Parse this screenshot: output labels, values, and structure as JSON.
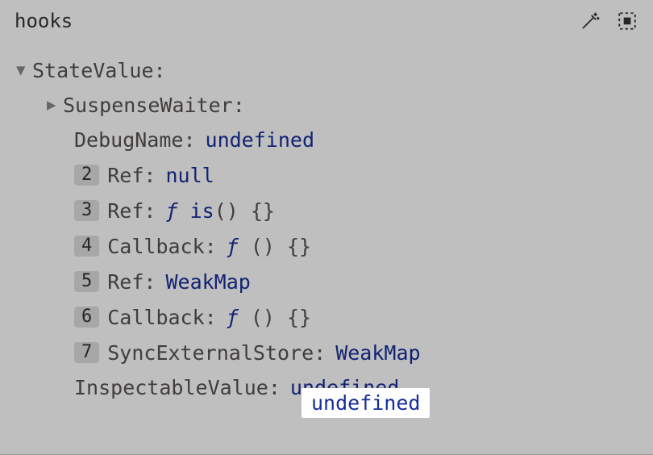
{
  "header": {
    "title": "hooks"
  },
  "tree": {
    "root": {
      "key": "StateValue",
      "expanded": true,
      "children": [
        {
          "key": "SuspenseWaiter",
          "expanded": false,
          "value": ""
        },
        {
          "key": "DebugName",
          "value": "undefined",
          "valueType": "undefined"
        },
        {
          "idx": "2",
          "key": "Ref",
          "value": "null",
          "valueType": "null"
        },
        {
          "idx": "3",
          "key": "Ref",
          "funcName": "is",
          "valueType": "func"
        },
        {
          "idx": "4",
          "key": "Callback",
          "funcName": "",
          "valueType": "func"
        },
        {
          "idx": "5",
          "key": "Ref",
          "value": "WeakMap",
          "valueType": "weakmap"
        },
        {
          "idx": "6",
          "key": "Callback",
          "funcName": "",
          "valueType": "func"
        },
        {
          "idx": "7",
          "key": "SyncExternalStore",
          "value": "WeakMap",
          "valueType": "weakmap"
        },
        {
          "key": "InspectableValue",
          "value": "undefined",
          "valueType": "undefined"
        }
      ]
    }
  },
  "highlight": {
    "value": "undefined"
  }
}
